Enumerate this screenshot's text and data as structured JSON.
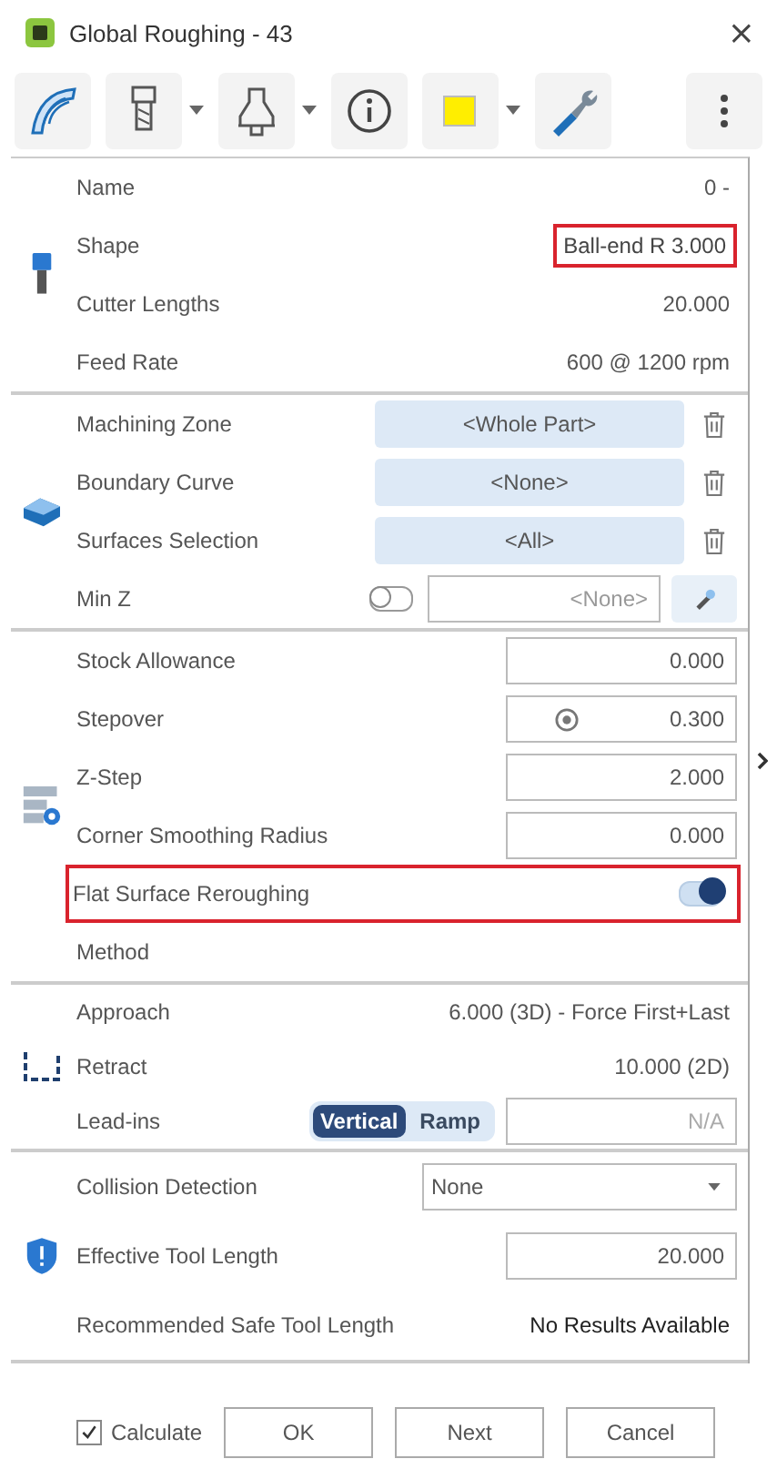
{
  "window": {
    "title": "Global Roughing - 43",
    "close": "×"
  },
  "toolbar": [
    {
      "kind": "toolpath",
      "dropdown": false
    },
    {
      "kind": "tool",
      "dropdown": true
    },
    {
      "kind": "holder",
      "dropdown": true
    },
    {
      "kind": "info",
      "dropdown": false
    },
    {
      "kind": "swatch",
      "color": "#ffee00",
      "dropdown": true
    },
    {
      "kind": "wrench",
      "dropdown": false
    },
    {
      "kind": "more",
      "dropdown": false
    }
  ],
  "sections": [
    {
      "kind": "tool",
      "rows": [
        {
          "kind": "text",
          "label": "Name",
          "value": "0 -",
          "highlighted": false
        },
        {
          "kind": "text",
          "label": "Shape",
          "value": "Ball-end R 3.000",
          "highlighted": true
        },
        {
          "kind": "text",
          "label": "Cutter Lengths",
          "value": "20.000",
          "highlighted": false
        },
        {
          "kind": "text",
          "label": "Feed Rate",
          "value": "600 @ 1200 rpm",
          "highlighted": false
        }
      ]
    },
    {
      "kind": "zone",
      "rows": [
        {
          "kind": "selector",
          "label": "Machining Zone",
          "value": "<Whole Part>",
          "highlighted": false
        },
        {
          "kind": "selector",
          "label": "Boundary Curve",
          "value": "<None>",
          "highlighted": false
        },
        {
          "kind": "selector",
          "label": "Surfaces Selection",
          "value": "<All>",
          "highlighted": false
        },
        {
          "kind": "minz",
          "label": "Min Z",
          "on": false,
          "placeholder": "<None>",
          "highlighted": false
        }
      ]
    },
    {
      "kind": "parameters",
      "rows": [
        {
          "kind": "input",
          "label": "Stock Allowance",
          "value": "0.000",
          "highlighted": false
        },
        {
          "kind": "input_icon",
          "label": "Stepover",
          "value": "0.300",
          "highlighted": false
        },
        {
          "kind": "input",
          "label": "Z-Step",
          "value": "2.000",
          "highlighted": false
        },
        {
          "kind": "input",
          "label": "Corner Smoothing Radius",
          "value": "0.000",
          "highlighted": false
        },
        {
          "kind": "toggle",
          "label": "Flat Surface Reroughing",
          "on": true,
          "highlighted": true
        },
        {
          "kind": "label",
          "label": "Method",
          "highlighted": false
        }
      ]
    },
    {
      "kind": "links",
      "rows": [
        {
          "kind": "text",
          "label": "Approach",
          "value": "6.000 (3D) - Force First+Last",
          "highlighted": false
        },
        {
          "kind": "text",
          "label": "Retract",
          "value": "10.000 (2D)",
          "highlighted": false
        },
        {
          "kind": "segmented",
          "label": "Lead-ins",
          "options": [
            {
              "label": "Vertical",
              "selected": true
            },
            {
              "label": "Ramp",
              "selected": false
            }
          ],
          "placeholder": "N/A",
          "highlighted": false
        }
      ]
    },
    {
      "kind": "safety",
      "rows": [
        {
          "kind": "dropdown",
          "label": "Collision Detection",
          "value": "None",
          "highlighted": false
        },
        {
          "kind": "input",
          "label": "Effective Tool Length",
          "value": "20.000",
          "highlighted": false
        },
        {
          "kind": "result",
          "label": "Recommended Safe Tool Length",
          "value": "No Results Available",
          "highlighted": false
        }
      ]
    }
  ],
  "footer": {
    "calculate": {
      "label": "Calculate",
      "checked": true
    },
    "buttons": [
      "OK",
      "Next",
      "Cancel"
    ]
  }
}
